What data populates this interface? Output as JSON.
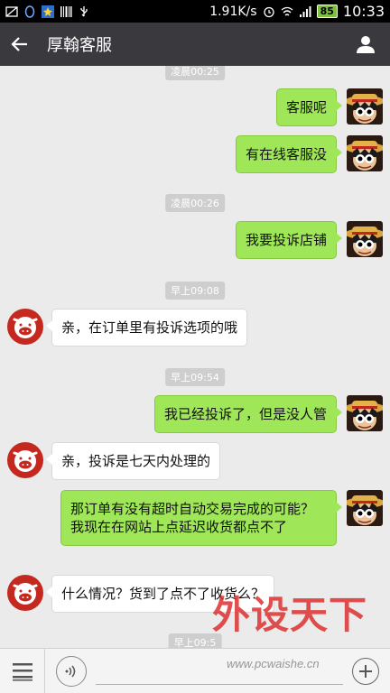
{
  "status_bar": {
    "network_speed": "1.91K/s",
    "battery_level": "85",
    "time": "10:33"
  },
  "header": {
    "title": "厚翰客服"
  },
  "messages": [
    {
      "type": "timestamp",
      "text": "凌晨00:25"
    },
    {
      "type": "sent",
      "text": "客服呢"
    },
    {
      "type": "sent",
      "text": "有在线客服没"
    },
    {
      "type": "timestamp",
      "text": "凌晨00:26"
    },
    {
      "type": "sent",
      "text": "我要投诉店铺"
    },
    {
      "type": "timestamp",
      "text": "早上09:08"
    },
    {
      "type": "received",
      "text": "亲，在订单里有投诉选项的哦"
    },
    {
      "type": "timestamp",
      "text": "早上09:54"
    },
    {
      "type": "sent",
      "text": "我已经投诉了，但是没人管"
    },
    {
      "type": "received",
      "text": "亲，投诉是七天内处理的"
    },
    {
      "type": "sent",
      "text": "那订单有没有超时自动交易完成的可能？我现在在网站上点延迟收货都点不了"
    },
    {
      "type": "received",
      "text": "什么情况？货到了点不了收货么？"
    },
    {
      "type": "timestamp",
      "text": "早上09:5"
    }
  ],
  "watermark": {
    "brand": "外设天下",
    "url": "www.pcwaishe.cn"
  },
  "colors": {
    "titlebar": "#3a3a3e",
    "sent_bubble": "#9fe658",
    "received_bubble": "#ffffff",
    "chat_bg": "#ebebeb"
  }
}
